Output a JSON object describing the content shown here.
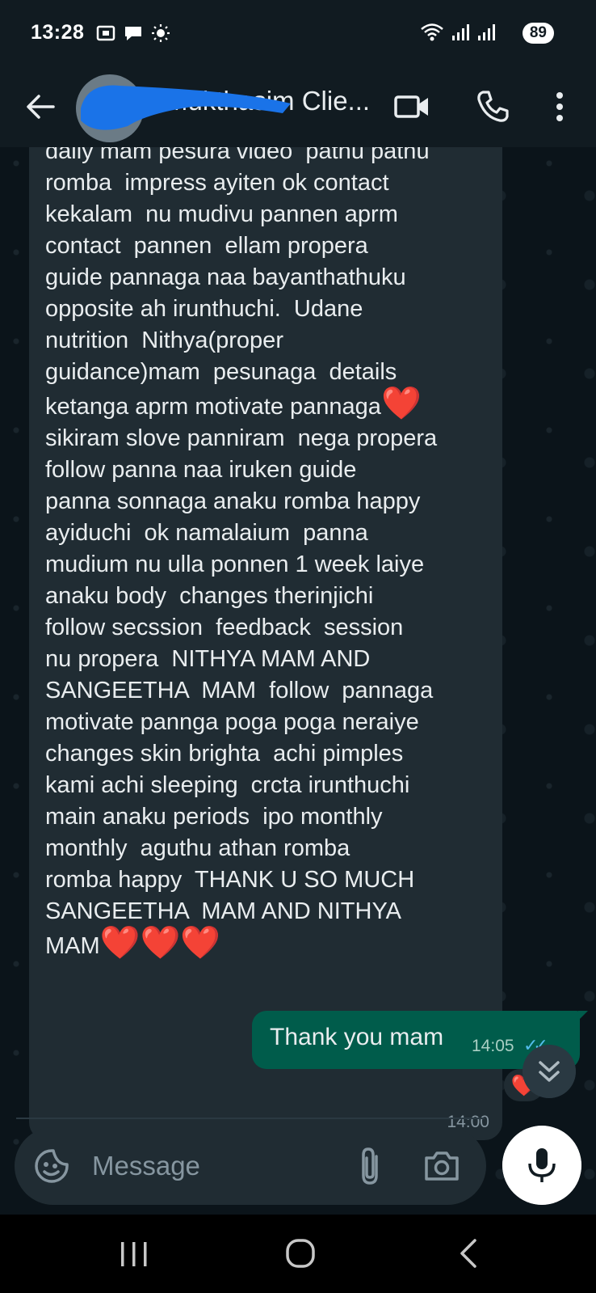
{
  "status_bar": {
    "time": "13:28",
    "battery": "89",
    "icons": [
      "screenshot-icon",
      "chat-bubble-icon",
      "brightness-icon",
      "wifi-icon",
      "signal-icon",
      "signal-icon"
    ]
  },
  "header": {
    "contact_name": "Mukthasim Clie...",
    "icons": [
      "back-arrow-icon",
      "video-call-icon",
      "phone-icon",
      "more-vertical-icon"
    ]
  },
  "messages": {
    "incoming": {
      "lines": [
        "daily mam pesura video  pathu pathu",
        "romba  impress ayiten ok contact",
        "kekalam  nu mudivu pannen aprm",
        "contact  pannen  ellam propera",
        "guide pannaga naa bayanthathuku",
        "opposite ah irunthuchi.  Udane",
        "nutrition  Nithya(proper",
        "guidance)mam  pesunaga  details",
        "ketanga aprm motivate pannaga",
        "sikiram slove panniram  nega propera",
        "follow panna naa iruken guide",
        "panna sonnaga anaku romba happy",
        "ayiduchi  ok namalaium  panna",
        "mudium nu ulla ponnen 1 week laiye",
        "anaku body  changes therinjichi",
        "follow secssion  feedback  session",
        "nu propera  NITHYA MAM AND",
        "SANGEETHA  MAM  follow  pannaga",
        "motivate pannga poga poga neraiye",
        "changes skin brighta  achi pimples",
        "kami achi sleeping  crcta irunthuchi",
        "main anaku periods  ipo monthly",
        "monthly  aguthu athan romba",
        "romba happy  THANK U SO MUCH",
        "SANGEETHA  MAM AND NITHYA",
        "MAM"
      ],
      "heart_after_line_9": "❤️",
      "hearts_end": "❤️❤️❤️",
      "time": "14:00"
    },
    "outgoing": {
      "text": "Thank you mam",
      "time": "14:05",
      "status_ticks": "✓✓",
      "reaction": "❤️"
    }
  },
  "input": {
    "placeholder": "Message"
  },
  "colors": {
    "background": "#0b141a",
    "bubble_in": "#202c33",
    "bubble_out": "#005c4b",
    "header": "#111b21",
    "read_ticks": "#53bdeb",
    "scribble": "#1a73e8"
  }
}
